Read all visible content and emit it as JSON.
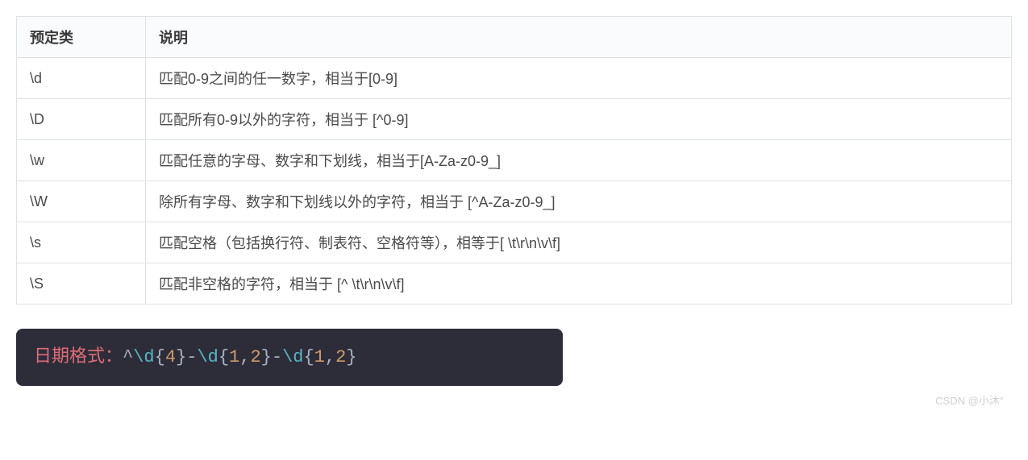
{
  "table": {
    "headers": [
      "预定类",
      "说明"
    ],
    "rows": [
      {
        "pattern": "\\d",
        "desc": "匹配0-9之间的任一数字，相当于[0-9]"
      },
      {
        "pattern": "\\D",
        "desc": "匹配所有0-9以外的字符，相当于   [^0-9]"
      },
      {
        "pattern": "\\w",
        "desc": "匹配任意的字母、数字和下划线，相当于[A-Za-z0-9_]"
      },
      {
        "pattern": "\\W",
        "desc": "除所有字母、数字和下划线以外的字符，相当于  [^A-Za-z0-9_]"
      },
      {
        "pattern": "\\s",
        "desc": "匹配空格（包括换行符、制表符、空格符等），相等于[ \\t\\r\\n\\v\\f]"
      },
      {
        "pattern": "\\S",
        "desc": "匹配非空格的字符，相当于  [^ \\t\\r\\n\\v\\f]"
      }
    ]
  },
  "code": {
    "label": "日期格式：",
    "tokens": [
      {
        "t": "^",
        "c": "tok-misc"
      },
      {
        "t": "\\d",
        "c": "tok-esc"
      },
      {
        "t": "{",
        "c": "tok-punc"
      },
      {
        "t": "4",
        "c": "tok-num"
      },
      {
        "t": "}",
        "c": "tok-punc"
      },
      {
        "t": "-",
        "c": "tok-misc"
      },
      {
        "t": "\\d",
        "c": "tok-esc"
      },
      {
        "t": "{",
        "c": "tok-punc"
      },
      {
        "t": "1",
        "c": "tok-num"
      },
      {
        "t": ",",
        "c": "tok-punc"
      },
      {
        "t": "2",
        "c": "tok-num"
      },
      {
        "t": "}",
        "c": "tok-punc"
      },
      {
        "t": "-",
        "c": "tok-misc"
      },
      {
        "t": "\\d",
        "c": "tok-esc"
      },
      {
        "t": "{",
        "c": "tok-punc"
      },
      {
        "t": "1",
        "c": "tok-num"
      },
      {
        "t": ",",
        "c": "tok-punc"
      },
      {
        "t": "2",
        "c": "tok-num"
      },
      {
        "t": "}",
        "c": "tok-punc"
      }
    ]
  },
  "watermark": "CSDN @小沐°"
}
